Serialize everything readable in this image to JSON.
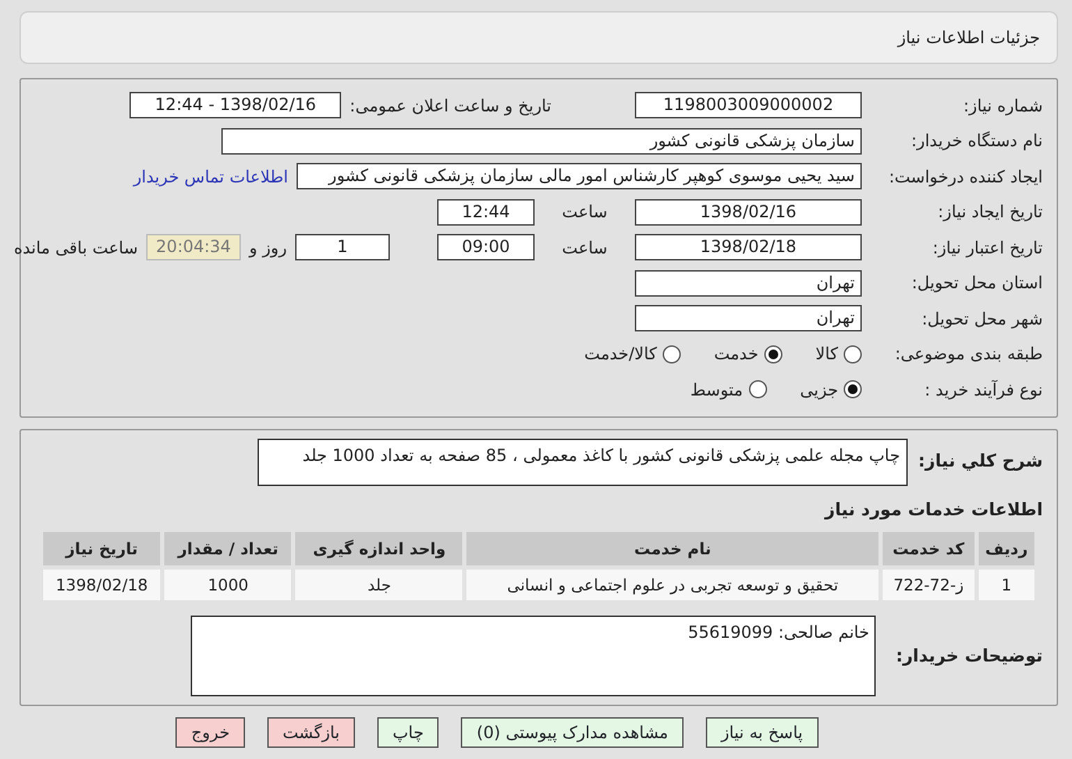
{
  "header": {
    "title": "جزئیات اطلاعات نیاز"
  },
  "details": {
    "need_number": {
      "label": "شماره نیاز:",
      "value": "1198003009000002"
    },
    "announce": {
      "label": "تاریخ و ساعت اعلان عمومی:",
      "value": "1398/02/16 - 12:44"
    },
    "buyer_org": {
      "label": "نام دستگاه خریدار:",
      "value": "سازمان پزشکی قانونی کشور"
    },
    "requester": {
      "label": "ایجاد کننده درخواست:",
      "value": "سید یحیی موسوی کوهپر کارشناس امور مالی سازمان پزشکی قانونی کشور",
      "link": "اطلاعات تماس خریدار"
    },
    "created": {
      "label": "تاریخ ایجاد نیاز:",
      "date": "1398/02/16",
      "time_label": "ساعت",
      "time": "12:44"
    },
    "validity": {
      "label": "تاریخ اعتبار نیاز:",
      "date": "1398/02/18",
      "time_label": "ساعت",
      "time": "09:00",
      "days": "1",
      "days_label": "روز و",
      "remaining": "20:04:34",
      "remaining_label": "ساعت باقی مانده"
    },
    "province": {
      "label": "استان محل تحویل:",
      "value": "تهران"
    },
    "city": {
      "label": "شهر محل تحویل:",
      "value": "تهران"
    },
    "category": {
      "label": "طبقه بندی موضوعی:",
      "options": [
        {
          "label": "کالا",
          "selected": false
        },
        {
          "label": "خدمت",
          "selected": true
        },
        {
          "label": "کالا/خدمت",
          "selected": false
        }
      ]
    },
    "process": {
      "label": "نوع فرآیند خرید :",
      "options": [
        {
          "label": "جزیی",
          "selected": true
        },
        {
          "label": "متوسط",
          "selected": false
        }
      ]
    }
  },
  "summary": {
    "label": "شرح کلي نياز:",
    "value": "چاپ مجله علمی پزشکی قانونی کشور با کاغذ معمولی ، 85 صفحه به تعداد 1000 جلد"
  },
  "services": {
    "title": "اطلاعات خدمات مورد نیاز",
    "columns": [
      "ردیف",
      "کد خدمت",
      "نام خدمت",
      "واحد اندازه گیری",
      "تعداد / مقدار",
      "تاریخ نیاز"
    ],
    "rows": [
      [
        "1",
        "ز-72-722",
        "تحقیق و توسعه تجربی در علوم اجتماعی و انسانی",
        "جلد",
        "1000",
        "1398/02/18"
      ]
    ]
  },
  "buyer_notes": {
    "label": "توضیحات خریدار:",
    "value": "خانم صالحی: 55619099"
  },
  "buttons": [
    {
      "label": "پاسخ به نیاز",
      "kind": "primary"
    },
    {
      "label": "مشاهده مدارک پیوستی (0)",
      "kind": "primary"
    },
    {
      "label": "چاپ",
      "kind": "primary"
    },
    {
      "label": "بازگشت",
      "kind": "danger"
    },
    {
      "label": "خروج",
      "kind": "danger"
    }
  ]
}
